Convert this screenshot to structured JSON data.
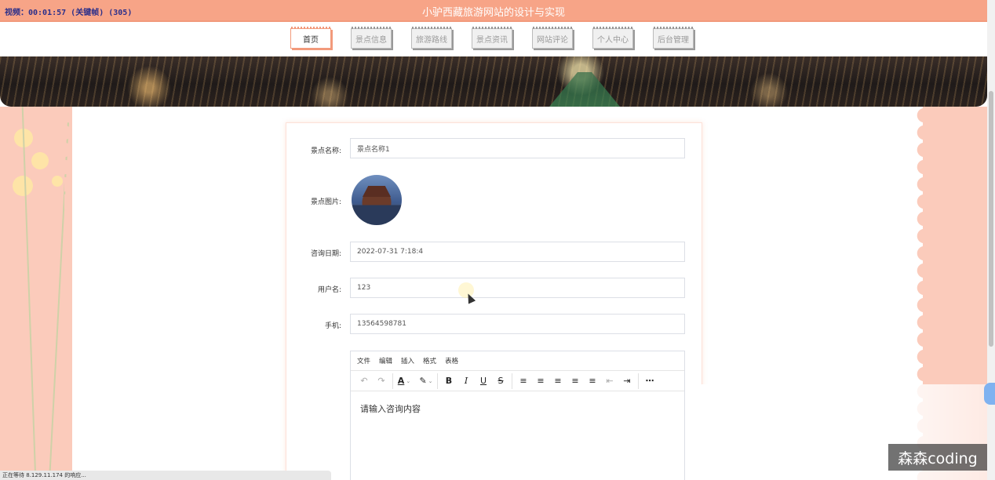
{
  "header": {
    "recording": "视频：00:01:57 (关键帧) (305)",
    "title": "小驴西藏旅游网站的设计与实现"
  },
  "nav": {
    "items": [
      {
        "label": "首页",
        "active": true
      },
      {
        "label": "景点信息",
        "active": false
      },
      {
        "label": "旅游路线",
        "active": false
      },
      {
        "label": "景点资讯",
        "active": false
      },
      {
        "label": "网站评论",
        "active": false
      },
      {
        "label": "个人中心",
        "active": false
      },
      {
        "label": "后台管理",
        "active": false
      }
    ]
  },
  "form": {
    "name_label": "景点名称:",
    "name_value": "景点名称1",
    "image_label": "景点图片:",
    "date_label": "咨询日期:",
    "date_value": "2022-07-31 7:18:4",
    "username_label": "用户名:",
    "username_value": "123",
    "phone_label": "手机:",
    "phone_value": "13564598781"
  },
  "editor": {
    "menus": [
      "文件",
      "编辑",
      "插入",
      "格式",
      "表格"
    ],
    "placeholder": "请输入咨询内容",
    "toolbar_icons": [
      "undo-icon",
      "redo-icon",
      "font-color-icon",
      "highlight-color-icon",
      "bold-icon",
      "italic-icon",
      "underline-icon",
      "strikethrough-icon",
      "line-height-icon",
      "align-left-icon",
      "align-center-icon",
      "align-right-icon",
      "justify-icon",
      "outdent-icon",
      "indent-icon",
      "more-icon"
    ]
  },
  "status": {
    "text": "正在等待 8.129.11.174 的响应..."
  },
  "watermark": {
    "text": "森森coding"
  },
  "colors": {
    "accent": "#f7a487",
    "side": "#fbcbbb"
  }
}
